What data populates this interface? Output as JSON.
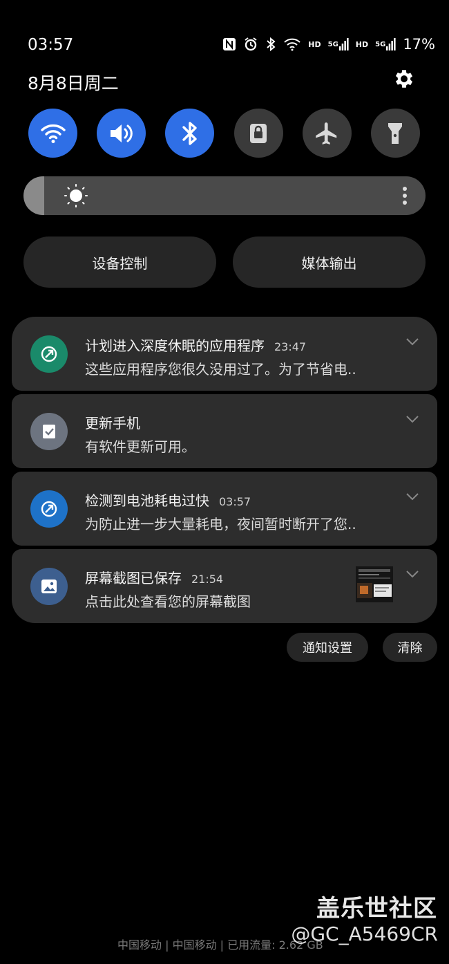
{
  "status": {
    "time": "03:57",
    "battery": "17%",
    "hd1": "HD",
    "sig1": "5G",
    "hd2": "HD",
    "sig2": "5G"
  },
  "header": {
    "date": "8月8日周二"
  },
  "quick_toggles": [
    {
      "name": "wifi",
      "on": true
    },
    {
      "name": "sound",
      "on": true
    },
    {
      "name": "bluetooth",
      "on": true
    },
    {
      "name": "rotation-lock",
      "on": false
    },
    {
      "name": "airplane",
      "on": false
    },
    {
      "name": "flashlight",
      "on": false
    }
  ],
  "brightness": {
    "level": 0.05
  },
  "pills": {
    "device_control": "设备控制",
    "media_output": "媒体输出"
  },
  "notifications": [
    {
      "title": "计划进入深度休眠的应用程序",
      "time": "23:47",
      "text": "这些应用程序您很久没用过了。为了节省电..",
      "icon_color": "#1a8a6a"
    },
    {
      "title": "更新手机",
      "time": "",
      "text": "有软件更新可用。",
      "icon_color": "#6d7480"
    },
    {
      "title": "检测到电池耗电过快",
      "time": "03:57",
      "text": "为防止进一步大量耗电，夜间暂时断开了您..",
      "icon_color": "#1e72c8"
    },
    {
      "title": "屏幕截图已保存",
      "time": "21:54",
      "text": "点击此处查看您的屏幕截图",
      "icon_color": "#3d5f8f"
    }
  ],
  "actions": {
    "notif_settings": "通知设置",
    "clear": "清除"
  },
  "footer": {
    "carrier": "中国移动 | 中国移动 | 已用流量: 2.62 GB",
    "watermark_brand": "盖乐世社区",
    "watermark_user": "@GC_A5469CR"
  },
  "colors": {
    "accent": "#2f6fe6",
    "card": "#2d2d2d"
  }
}
